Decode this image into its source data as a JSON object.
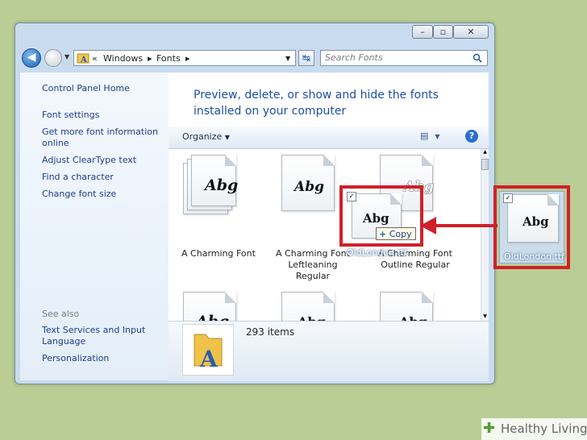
{
  "window": {
    "caption": {
      "minimize": "–",
      "maximize": "▫",
      "close": "✕"
    },
    "address": {
      "separator": "«",
      "segments": [
        "Windows",
        "Fonts"
      ]
    },
    "search": {
      "placeholder": "Search Fonts"
    }
  },
  "left_pane": {
    "home": "Control Panel Home",
    "tasks": [
      "Font settings",
      "Get more font information online",
      "Adjust ClearType text",
      "Find a character",
      "Change font size"
    ],
    "see_also_label": "See also",
    "see_also": [
      "Text Services and Input Language",
      "Personalization"
    ]
  },
  "main": {
    "heading": "Preview, delete, or show and hide the fonts installed on your computer",
    "toolbar": {
      "organize": "Organize"
    },
    "fonts": [
      {
        "name": "A Charming Font",
        "preview": "Abg"
      },
      {
        "name": "A Charming Font Leftleaning Regular",
        "preview": "Abg"
      },
      {
        "name": "A Charming Font Outline Regular",
        "preview": "Abg"
      },
      {
        "name": "",
        "preview": "Abg"
      },
      {
        "name": "",
        "preview": "Abg"
      },
      {
        "name": "",
        "preview": "Abg"
      }
    ]
  },
  "details": {
    "item_count": "293 items"
  },
  "drag": {
    "file_name": "OldLondon.ttf",
    "preview": "Abg",
    "tooltip": "Copy"
  },
  "brand": {
    "name": "Healthy Living"
  },
  "colors": {
    "highlight": "#d0202a",
    "link": "#1e3c8c",
    "heading": "#1e4ea8"
  }
}
